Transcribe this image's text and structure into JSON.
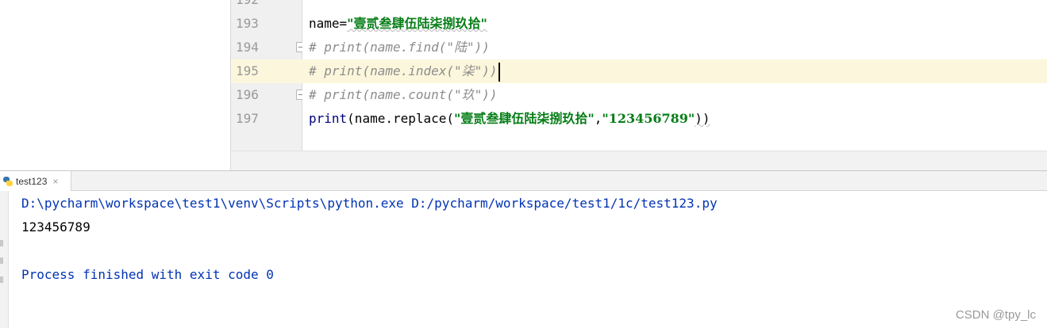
{
  "editor": {
    "line_numbers": [
      "192",
      "193",
      "194",
      "195",
      "196",
      "197"
    ],
    "lines": [
      {
        "plain": "name=",
        "string": "\"壹贰叁肆伍陆柒捌玖拾\""
      },
      {
        "comment": "# print(name.find(\"陆\"))"
      },
      {
        "comment": "# print(name.index(\"柒\"))"
      },
      {
        "comment": "# print(name.count(\"玖\"))"
      },
      {
        "p1": "print",
        "p2": "(name.replace(",
        "s1": "\"壹贰叁肆伍陆柒捌玖拾\"",
        "p3": ",",
        "s2": "\"123456789\"",
        "p4": "))"
      }
    ]
  },
  "run": {
    "tab_label": "test123",
    "tab_close": "×",
    "output": {
      "command": "D:\\pycharm\\workspace\\test1\\venv\\Scripts\\python.exe D:/pycharm/workspace/test1/1c/test123.py",
      "result": "123456789",
      "exit": "Process finished with exit code 0"
    }
  },
  "watermark": "CSDN @tpy_lc",
  "colors": {
    "keyword_string": "#067d17",
    "comment": "#8c8c8c",
    "console_system": "#0033b3",
    "current_line": "#fcf7dc"
  }
}
